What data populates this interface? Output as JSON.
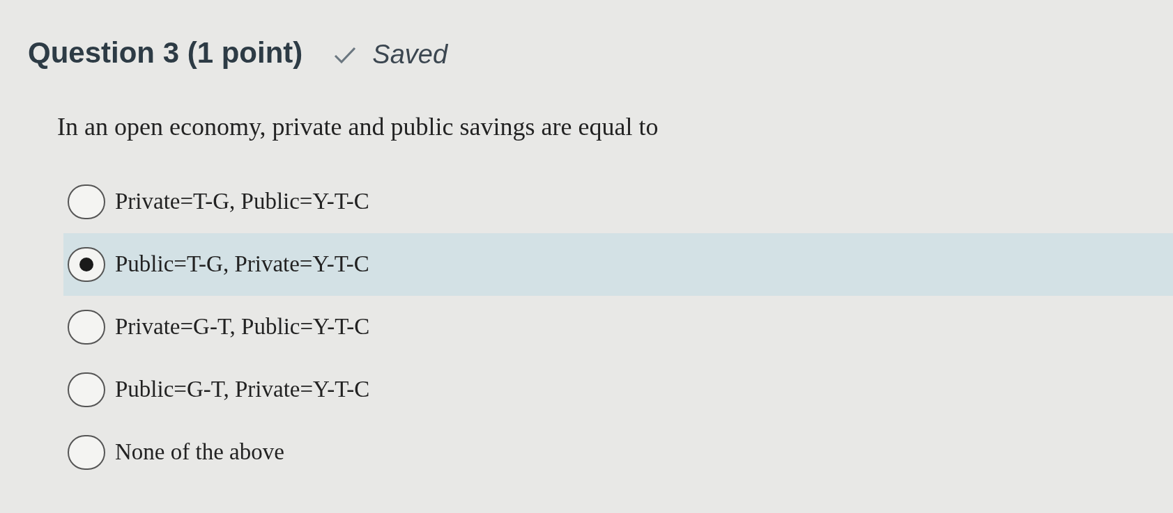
{
  "question": {
    "title": "Question 3 (1 point)",
    "status": "Saved",
    "prompt": "In an open economy, private and public savings are equal to"
  },
  "options": [
    {
      "label": "Private=T-G, Public=Y-T-C",
      "selected": false
    },
    {
      "label": "Public=T-G, Private=Y-T-C",
      "selected": true
    },
    {
      "label": "Private=G-T, Public=Y-T-C",
      "selected": false
    },
    {
      "label": "Public=G-T, Private=Y-T-C",
      "selected": false
    },
    {
      "label": "None of the above",
      "selected": false
    }
  ]
}
